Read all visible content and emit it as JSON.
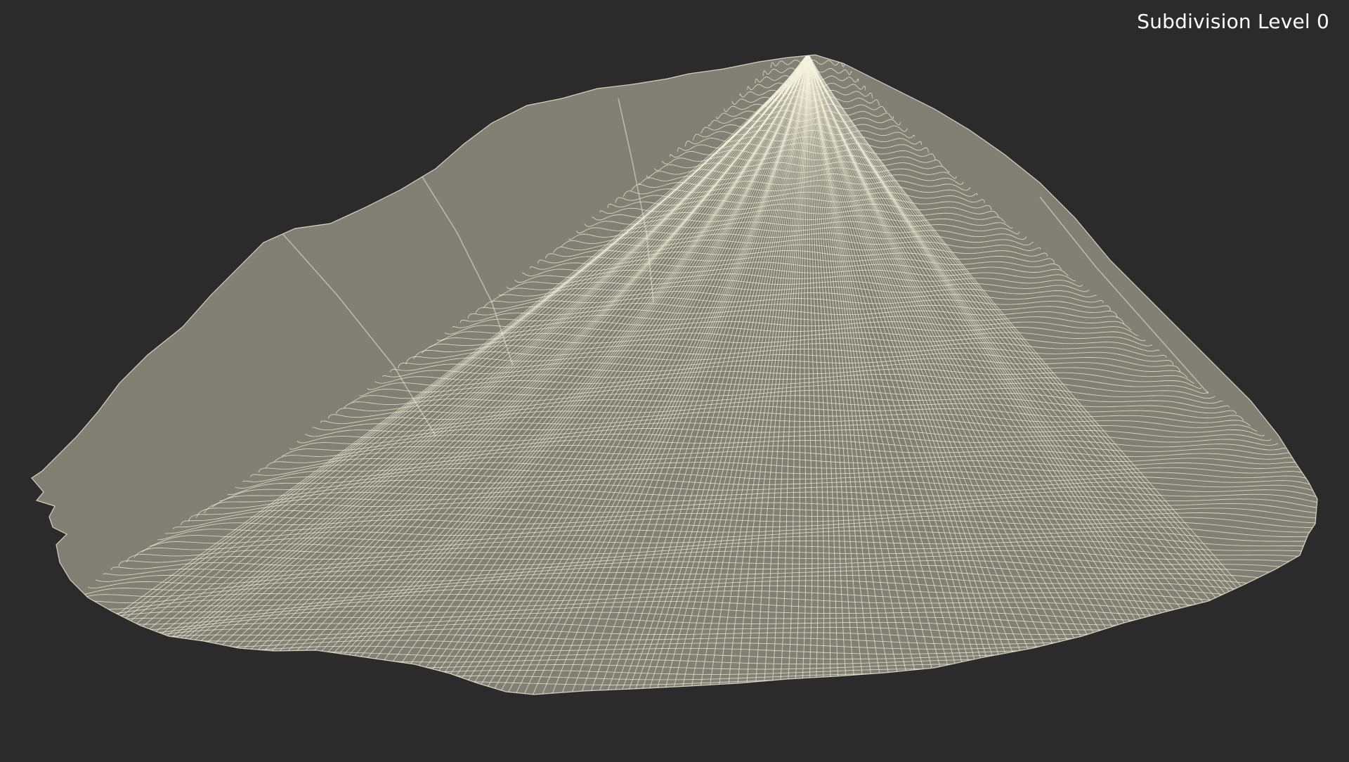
{
  "viewport": {
    "background": "#2b2b2b",
    "label": "Subdivision Level 0"
  },
  "model": {
    "icon": "wireframe-mound",
    "surface_color": "#808074",
    "wire_color": "#f4f2dc"
  }
}
